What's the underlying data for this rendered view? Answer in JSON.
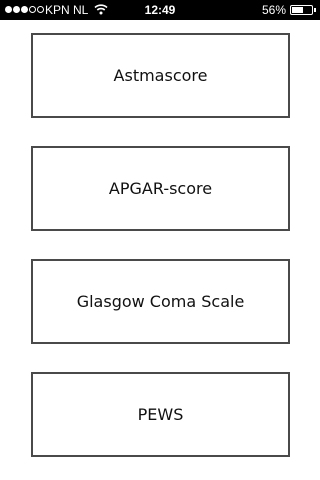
{
  "status_bar": {
    "signal_bars_filled": 3,
    "signal_bars_total": 5,
    "carrier": "KPN NL",
    "wifi_icon": "wifi-icon",
    "time": "12:49",
    "battery_percent": "56%",
    "battery_level": 0.56
  },
  "menu": {
    "items": [
      {
        "label": "Astmascore"
      },
      {
        "label": "APGAR-score"
      },
      {
        "label": "Glasgow Coma Scale"
      },
      {
        "label": "PEWS"
      }
    ]
  },
  "colors": {
    "status_bar_background": "#000000",
    "page_background": "#ffffff",
    "button_border": "#4a4a4a",
    "text": "#111111"
  }
}
